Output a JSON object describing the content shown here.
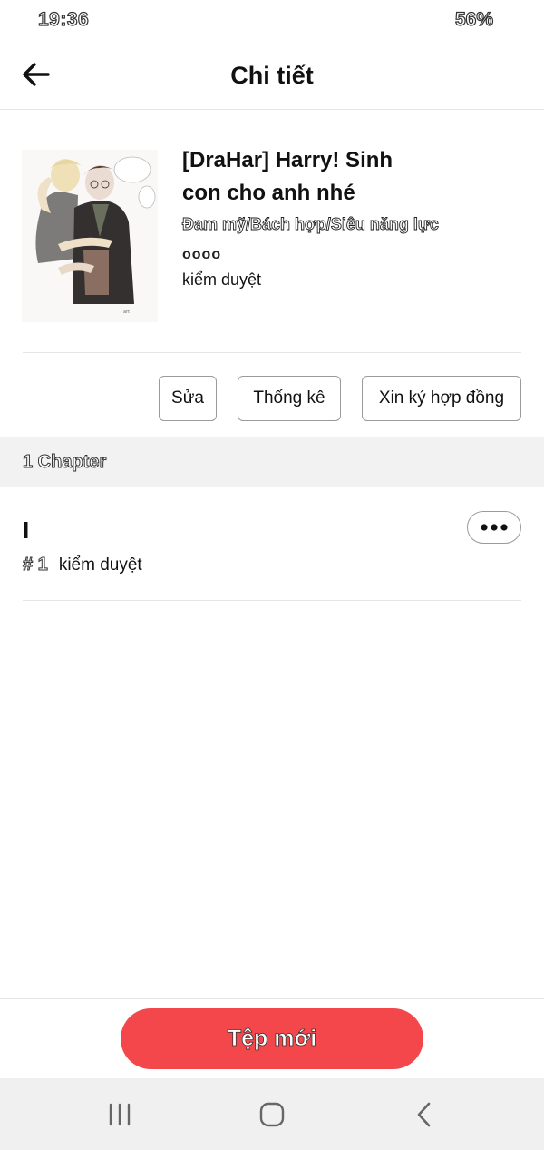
{
  "status_bar": {
    "time": "19:36",
    "battery": "56%"
  },
  "header": {
    "title": "Chi tiết",
    "back_icon": "arrow-left-icon"
  },
  "book": {
    "title_line1": "[DraHar] Harry! Sinh",
    "title_line2": "con cho anh nhé",
    "genres": "Đam mỹ/Bách hợp/Siêu năng lực",
    "description": "oooo",
    "status": "kiểm duyệt"
  },
  "actions": {
    "edit": "Sửa",
    "stats": "Thống kê",
    "contract": "Xin ký hợp đồng"
  },
  "chapters": {
    "count_label": "1 Chapter",
    "items": [
      {
        "title": "I",
        "number": "# 1",
        "status": "kiểm duyệt"
      }
    ]
  },
  "bottom": {
    "new_file": "Tệp mới"
  },
  "nav": {
    "recent_icon": "recent-apps-icon",
    "home_icon": "home-icon",
    "back_icon": "back-chevron-icon"
  }
}
